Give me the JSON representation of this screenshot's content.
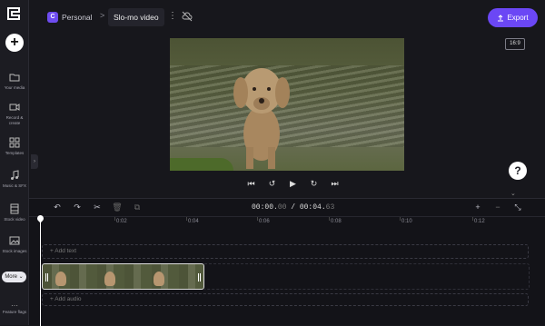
{
  "app": {
    "logo_letter": "C",
    "accent": "#6b47f5"
  },
  "sidebar": {
    "add_label": "+",
    "items": [
      {
        "label": "Your media",
        "icon": "folder-icon"
      },
      {
        "label": "Record & create",
        "icon": "camera-icon"
      },
      {
        "label": "Templates",
        "icon": "templates-icon"
      },
      {
        "label": "Music & SFX",
        "icon": "music-icon"
      },
      {
        "label": "Stock video",
        "icon": "film-icon"
      },
      {
        "label": "Stock images",
        "icon": "image-icon"
      }
    ],
    "more_label": "More",
    "flags_label": "Feature flags"
  },
  "header": {
    "workspace_badge": "C",
    "workspace_name": "Personal",
    "separator": ">",
    "project_title": "Slo-mo video",
    "export_label": "Export"
  },
  "preview": {
    "aspect_ratio": "16:9"
  },
  "player": {
    "help_label": "?"
  },
  "timeline": {
    "timecode_current": "00:00.",
    "timecode_current_ms": "00",
    "timecode_sep": " / ",
    "timecode_total": "00:04.",
    "timecode_total_ms": "63",
    "ticks": [
      "0:02",
      "0:04",
      "0:06",
      "0:08",
      "0:10",
      "0:12"
    ],
    "add_text_label": "+ Add text",
    "add_audio_label": "+ Add audio"
  }
}
